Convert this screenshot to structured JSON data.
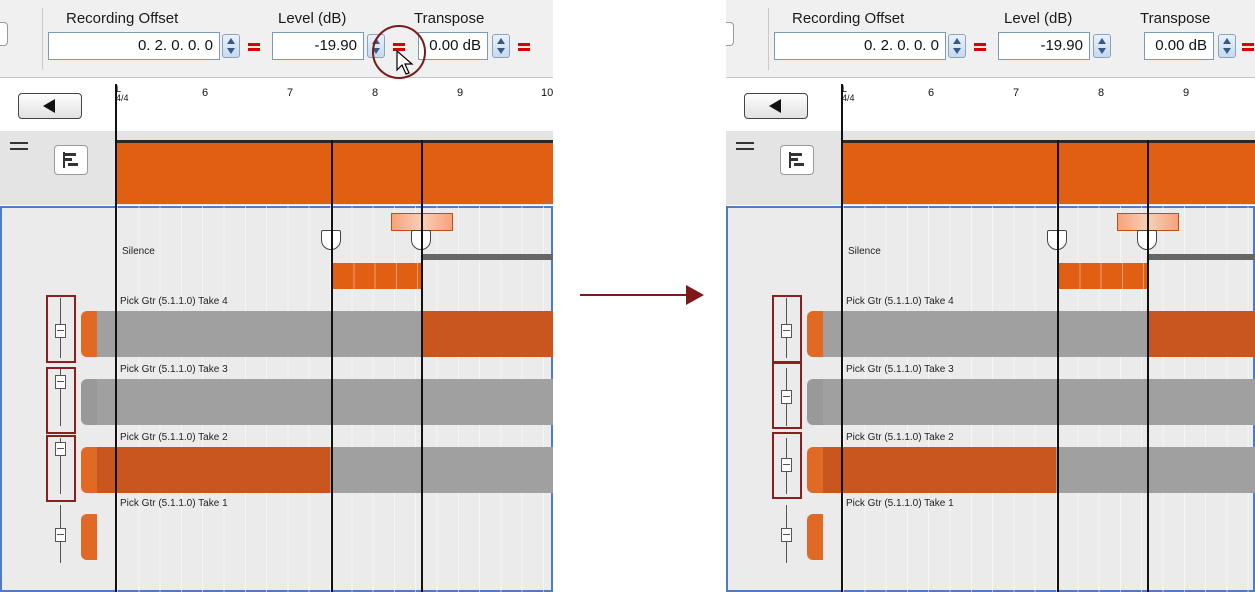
{
  "before": {
    "toolbar": {
      "recording_offset_label": "Recording Offset",
      "level_label": "Level (dB)",
      "transpose_label": "Transpose",
      "recording_offset_value": "0. 2. 0.   0. 0",
      "level_value": "-19.90",
      "transpose_value": "0.00 dB"
    },
    "ruler": {
      "marker": "L",
      "time_sig": "4/4",
      "bars": [
        "6",
        "7",
        "8",
        "9",
        "10"
      ]
    },
    "silence_label": "Silence",
    "takes": [
      "Pick Gtr (5.1.1.0) Take 4",
      "Pick Gtr (5.1.1.0) Take 3",
      "Pick Gtr (5.1.1.0) Take 2",
      "Pick Gtr (5.1.1.0) Take 1"
    ]
  },
  "after": {
    "toolbar": {
      "recording_offset_label": "Recording Offset",
      "level_label": "Level (dB)",
      "transpose_label": "Transpose",
      "recording_offset_value": "0. 2. 0.   0. 0",
      "level_value": "-19.90",
      "transpose_value": "0.00 dB"
    },
    "ruler": {
      "marker": "L",
      "time_sig": "4/4",
      "bars": [
        "6",
        "7",
        "8",
        "9"
      ]
    },
    "silence_label": "Silence",
    "takes": [
      "Pick Gtr (5.1.1.0) Take 4",
      "Pick Gtr (5.1.1.0) Take 3",
      "Pick Gtr (5.1.1.0) Take 2",
      "Pick Gtr (5.1.1.0) Take 1"
    ]
  },
  "colors": {
    "clip_orange": "#e15f13",
    "take_orange": "#c8561e",
    "link_red": "#d80000",
    "highlight": "#8b1e1e"
  },
  "icons": [
    "spin-icon",
    "link-icon",
    "back-arrow-icon",
    "lane-view-icon",
    "fader-icon",
    "fade-handle-icon",
    "pointer-icon"
  ]
}
